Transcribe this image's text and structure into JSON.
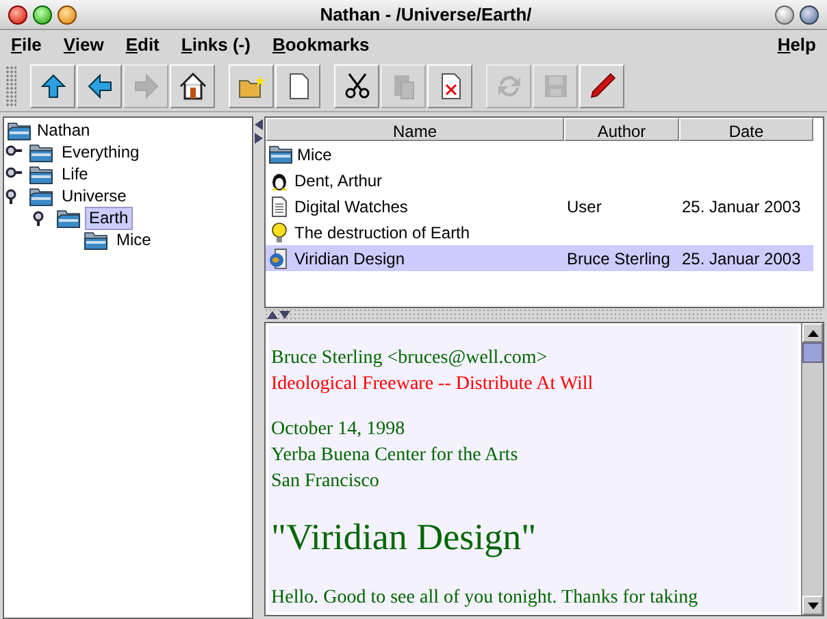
{
  "window": {
    "title": "Nathan - /Universe/Earth/"
  },
  "menu": {
    "left": [
      "File",
      "View",
      "Edit",
      "Links (-)",
      "Bookmarks"
    ],
    "right": [
      "Help"
    ]
  },
  "toolbar": [
    [
      {
        "kind": "up",
        "disabled": false
      },
      {
        "kind": "back",
        "disabled": false
      },
      {
        "kind": "forward",
        "disabled": true
      },
      {
        "kind": "home",
        "disabled": false
      }
    ],
    [
      {
        "kind": "new-folder",
        "disabled": false
      },
      {
        "kind": "new-document",
        "disabled": false
      }
    ],
    [
      {
        "kind": "cut",
        "disabled": false
      },
      {
        "kind": "paste",
        "disabled": true
      },
      {
        "kind": "delete",
        "disabled": false
      }
    ],
    [
      {
        "kind": "refresh",
        "disabled": true
      },
      {
        "kind": "save",
        "disabled": true
      },
      {
        "kind": "edit",
        "disabled": false
      }
    ]
  ],
  "tree": {
    "label": "Nathan",
    "children": [
      {
        "label": "Everything",
        "expanded": false,
        "selected": false
      },
      {
        "label": "Life",
        "expanded": false,
        "selected": false
      },
      {
        "label": "Universe",
        "expanded": true,
        "selected": false,
        "children": [
          {
            "label": "Earth",
            "expanded": true,
            "selected": true,
            "children": [
              {
                "label": "Mice",
                "selected": false
              }
            ]
          }
        ]
      }
    ]
  },
  "table": {
    "columns": [
      "Name",
      "Author",
      "Date"
    ],
    "rows": [
      {
        "kind": "folder",
        "name": "Mice",
        "selected": false
      },
      {
        "kind": "person",
        "name": "Dent, Arthur",
        "selected": false
      },
      {
        "kind": "document",
        "name": "Digital Watches",
        "author": "User",
        "date": "25. Januar 2003",
        "selected": false
      },
      {
        "kind": "idea",
        "name": "The destruction of Earth",
        "selected": false
      },
      {
        "kind": "web",
        "name": "Viridian Design",
        "author": "Bruce Sterling",
        "date": "25. Januar 2003",
        "selected": true
      }
    ]
  },
  "document": [
    {
      "kind": "text",
      "lines": [
        {
          "text": "Bruce Sterling <bruces@well.com>",
          "color": "#006600"
        },
        {
          "text": "Ideological Freeware -- Distribute At Will",
          "color": "#ff0000"
        }
      ]
    },
    {
      "kind": "text",
      "lines": [
        {
          "text": "October 14, 1998",
          "color": "#006600"
        },
        {
          "text": "Yerba Buena Center for the Arts",
          "color": "#006600"
        },
        {
          "text": "San Francisco",
          "color": "#006600"
        }
      ]
    },
    {
      "kind": "heading",
      "lines": [
        {
          "text": "\"Viridian Design\"",
          "color": "#006600"
        }
      ]
    },
    {
      "kind": "text",
      "lines": [
        {
          "text": "Hello. Good to see all of you tonight. Thanks for taking",
          "color": "#006600"
        }
      ]
    }
  ]
}
